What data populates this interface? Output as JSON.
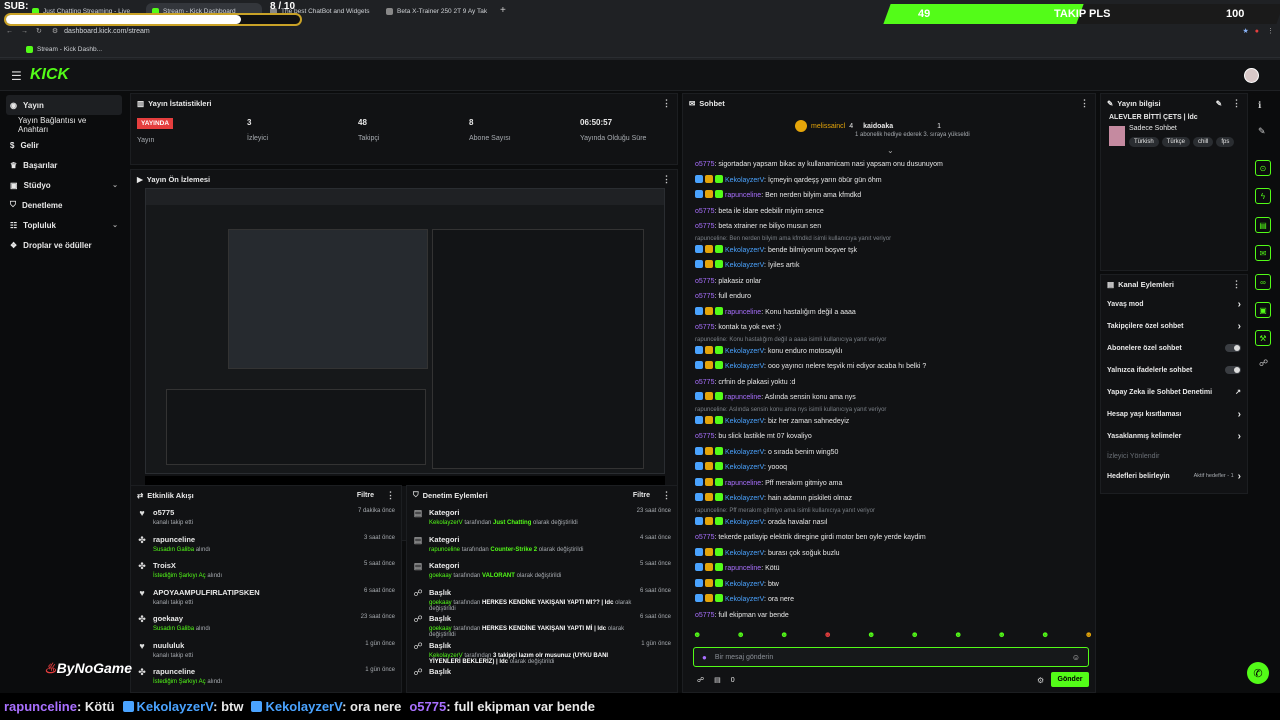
{
  "overlay": {
    "sub_label": "SUB:",
    "sub_count": "8 / 10",
    "follow_count": "49",
    "follow_label": "TAKIP PLS",
    "follow_goal": "100"
  },
  "browser": {
    "tabs": [
      {
        "label": "Just Chatting Streaming - Live"
      },
      {
        "label": "Stream - Kick Dashboard"
      },
      {
        "label": "The best ChatBot and Widgets"
      },
      {
        "label": "Beta X-Trainer 250 2T 9 Ay Tak"
      }
    ],
    "url": "dashboard.kick.com/stream",
    "bookmark": "Stream - Kick Dashb..."
  },
  "brand": "KICK",
  "sidebar": [
    {
      "label": "Yayın",
      "active": true
    },
    {
      "label": "Yayın Bağlantısı ve Anahtarı",
      "sub": true
    },
    {
      "label": "Gelir"
    },
    {
      "label": "Başarılar"
    },
    {
      "label": "Stüdyo",
      "chev": true
    },
    {
      "label": "Denetleme"
    },
    {
      "label": "Topluluk",
      "chev": true
    },
    {
      "label": "Droplar ve ödüller"
    }
  ],
  "stats": {
    "title": "Yayın İstatistikleri",
    "live_badge": "YAYINDA",
    "live_label": "Yayın",
    "items": [
      {
        "value": "3",
        "label": "İzleyici"
      },
      {
        "value": "48",
        "label": "Takipçi"
      },
      {
        "value": "8",
        "label": "Abone Sayısı"
      },
      {
        "value": "06:50:57",
        "label": "Yayında Olduğu Süre"
      }
    ]
  },
  "preview": {
    "title": "Yayın Ön İzlemesi"
  },
  "activity": {
    "title": "Etkinlik Akışı",
    "filter": "Filtre",
    "items": [
      {
        "name": "o5775",
        "sub": "kanalı takip etti",
        "time": "7 dakika önce",
        "icon": "heart"
      },
      {
        "name": "rapunceline",
        "sub": "Susadın Galiba",
        "sub2": " alındı",
        "time": "3 saat önce",
        "icon": "reward"
      },
      {
        "name": "TroisX",
        "sub": "İstediğim Şarkıyı Aç",
        "sub2": " alındı",
        "time": "5 saat önce",
        "icon": "reward"
      },
      {
        "name": "APOYAAMPULFIRLATIPSKEN",
        "sub": "kanalı takip etti",
        "time": "6 saat önce",
        "icon": "heart"
      },
      {
        "name": "goekaay",
        "sub": "Susadın Galiba",
        "sub2": " alındı",
        "time": "23 saat önce",
        "icon": "reward"
      },
      {
        "name": "nuululuk",
        "sub": "kanalı takip etti",
        "time": "1 gün önce",
        "icon": "heart"
      },
      {
        "name": "rapunceline",
        "sub": "İstediğim Şarkıyı Aç",
        "sub2": " alındı",
        "time": "1 gün önce",
        "icon": "reward"
      }
    ]
  },
  "moderation": {
    "title": "Denetim Eylemleri",
    "filter": "Filtre",
    "items": [
      {
        "name": "Kategori",
        "user": "KekolayzerV",
        "mid": " tarafından ",
        "val": "Just Chatting",
        "end": " olarak değiştirildi",
        "time": "23 saat önce"
      },
      {
        "name": "Kategori",
        "user": "rapunceline",
        "mid": " tarafından ",
        "val": "Counter-Strike 2",
        "end": " olarak değiştirildi",
        "time": "4 saat önce"
      },
      {
        "name": "Kategori",
        "user": "goekaay",
        "mid": " tarafından ",
        "val": "VALORANT",
        "end": " olarak değiştirildi",
        "time": "5 saat önce"
      },
      {
        "name": "Başlık",
        "user": "goekaay",
        "mid": " tarafından ",
        "val": "HERKES KENDİNE YAKIŞANI YAPTI MI?? | ldc",
        "end": " olarak değiştirildi",
        "time": "6 saat önce"
      },
      {
        "name": "Başlık",
        "user": "goekaay",
        "mid": " tarafından ",
        "val": "HERKES KENDİNE YAKIŞANI YAPTI Mİ | ldc",
        "end": " olarak değiştirildi",
        "time": "6 saat önce"
      },
      {
        "name": "Başlık",
        "user": "KekolayzerV",
        "mid": " tarafından ",
        "val": "3 takipçi lazım olr musunuz (UYKU BANI YİYENLERİ BEKLERİZ) | ldc",
        "end": " olarak değiştirildi",
        "time": "1 gün önce"
      },
      {
        "name": "Başlık",
        "user": "",
        "mid": "",
        "val": "",
        "end": "",
        "time": ""
      }
    ]
  },
  "chat": {
    "title": "Sohbet",
    "top_user": "melissaincl",
    "top_count": "4",
    "gift_user": "kaidoaka",
    "gift_count": "1",
    "gift_text": "1 abonelik hediye ederek 3. sıraya yükseldi",
    "messages": [
      {
        "user": "o5775",
        "c": "o",
        "text": "sigortadan yapsam bikac ay kullanamicam nasi yapsam onu dusunuyom"
      },
      {
        "user": "KekolayzerV",
        "c": "k",
        "text": "İçmeyin qardeşş yarın öbür gün öhm",
        "badges": true
      },
      {
        "user": "rapunceline",
        "c": "r",
        "text": "Ben nerden bilyim ama kfmdkd",
        "badges": true
      },
      {
        "user": "o5775",
        "c": "o",
        "text": "beta ile idare edebilir miyim sence"
      },
      {
        "user": "o5775",
        "c": "o",
        "text": "beta xtrainer ne biliyo musun sen"
      },
      {
        "reply": "rapunceline: Ben nerden bilyim ama kfmdkd isimli kullanıcıya yanıt veriyor",
        "user": "KekolayzerV",
        "c": "k",
        "text": "bende bilmiyorum boşver tşk",
        "badges": true
      },
      {
        "user": "KekolayzerV",
        "c": "k",
        "text": "İyiles artık",
        "badges": true
      },
      {
        "user": "o5775",
        "c": "o",
        "text": "plakasiz onlar"
      },
      {
        "user": "o5775",
        "c": "o",
        "text": "full enduro"
      },
      {
        "user": "rapunceline",
        "c": "r",
        "text": "Konu hastalığım değil a aaaa",
        "badges": true
      },
      {
        "user": "o5775",
        "c": "o",
        "text": "kontak ta yok evet :)"
      },
      {
        "reply": "rapunceline: Konu hastalığım değil a aaaa isimli kullanıcıya yanıt veriyor",
        "user": "KekolayzerV",
        "c": "k",
        "text": "konu enduro motosayklı",
        "badges": true
      },
      {
        "user": "KekolayzerV",
        "c": "k",
        "text": "ooo yayıncı nelere teşvik mi ediyor acaba hı belki ?",
        "badges": true
      },
      {
        "user": "o5775",
        "c": "o",
        "text": "crfnin de plakasi yoktu :d"
      },
      {
        "user": "rapunceline",
        "c": "r",
        "text": "Aslında sensin konu ama nys",
        "badges": true
      },
      {
        "reply": "rapunceline: Aslında sensin konu ama nys isimli kullanıcıya yanıt veriyor",
        "user": "KekolayzerV",
        "c": "k",
        "text": "biz her zaman sahnedeyiz",
        "badges": true
      },
      {
        "user": "o5775",
        "c": "o",
        "text": "bu slick lastikle mt 07 kovaliyo"
      },
      {
        "user": "KekolayzerV",
        "c": "k",
        "text": "o sırada benim wing50",
        "badges": true
      },
      {
        "user": "KekolayzerV",
        "c": "k",
        "text": "yoooq",
        "badges": true
      },
      {
        "user": "rapunceline",
        "c": "r",
        "text": "Pff merakım gitmiyo ama",
        "badges": true
      },
      {
        "user": "KekolayzerV",
        "c": "k",
        "text": "hain adamın piskileti olmaz",
        "badges": true
      },
      {
        "reply": "rapunceline: Pff merakım gitmiyo ama isimli kullanıcıya yanıt veriyor",
        "user": "KekolayzerV",
        "c": "k",
        "text": "orada havalar nasıl",
        "badges": true
      },
      {
        "user": "o5775",
        "c": "o",
        "text": "tekerde patlayip elektrik diregine girdi motor ben oyle yerde kaydim"
      },
      {
        "user": "KekolayzerV",
        "c": "k",
        "text": "burası çok soğuk buzlu",
        "badges": true
      },
      {
        "user": "rapunceline",
        "c": "r",
        "text": "Kötü",
        "badges": true
      },
      {
        "user": "KekolayzerV",
        "c": "k",
        "text": "btw",
        "badges": true
      },
      {
        "user": "KekolayzerV",
        "c": "k",
        "text": "ora nere",
        "badges": true
      },
      {
        "user": "o5775",
        "c": "o",
        "text": "full ekipman var bende"
      }
    ],
    "placeholder": "Bir mesaj gönderin",
    "points": "0",
    "send": "Gönder"
  },
  "stream_info": {
    "title": "Yayın bilgisi",
    "stream_title": "ALEVLER BİTTİ ÇETS | ldc",
    "category": "Sadece Sohbet",
    "tags": [
      "Türkish",
      "Türkçe",
      "chill",
      "fps"
    ]
  },
  "channel_actions": {
    "title": "Kanal Eylemleri",
    "items": [
      {
        "label": "Yavaş mod",
        "kind": "chev"
      },
      {
        "label": "Takipçilere özel sohbet",
        "kind": "chev"
      },
      {
        "label": "Abonelere özel sohbet",
        "kind": "toggle"
      },
      {
        "label": "Yalnızca ifadelerle sohbet",
        "kind": "toggle"
      },
      {
        "label": "Yapay Zeka ile Sohbet Denetimi",
        "kind": "ext"
      },
      {
        "label": "Hesap yaşı kısıtlaması",
        "kind": "chev"
      },
      {
        "label": "Yasaklanmış kelimeler",
        "kind": "chev"
      },
      {
        "label": "İzleyici Yönlendir",
        "kind": "dim"
      },
      {
        "label": "Hedefleri belirleyin",
        "kind": "chev",
        "extra": "Aktif hedefler - 1"
      }
    ]
  },
  "ticker": [
    {
      "user": "rapunceline",
      "text": ": Kötü",
      "c": "#a970ff"
    },
    {
      "user": "KekolayzerV",
      "text": ": btw",
      "c": "#4aa3ff"
    },
    {
      "user": "KekolayzerV",
      "text": ": ora nere",
      "c": "#4aa3ff"
    },
    {
      "user": "o5775",
      "text": ": full ekipman var bende",
      "c": "#a970ff"
    }
  ],
  "watermark": "ByNoGame",
  "colors": {
    "accent": "#53fc18",
    "live": "#e53e3e",
    "user_purple": "#a970ff",
    "user_blue": "#4aa3ff"
  }
}
